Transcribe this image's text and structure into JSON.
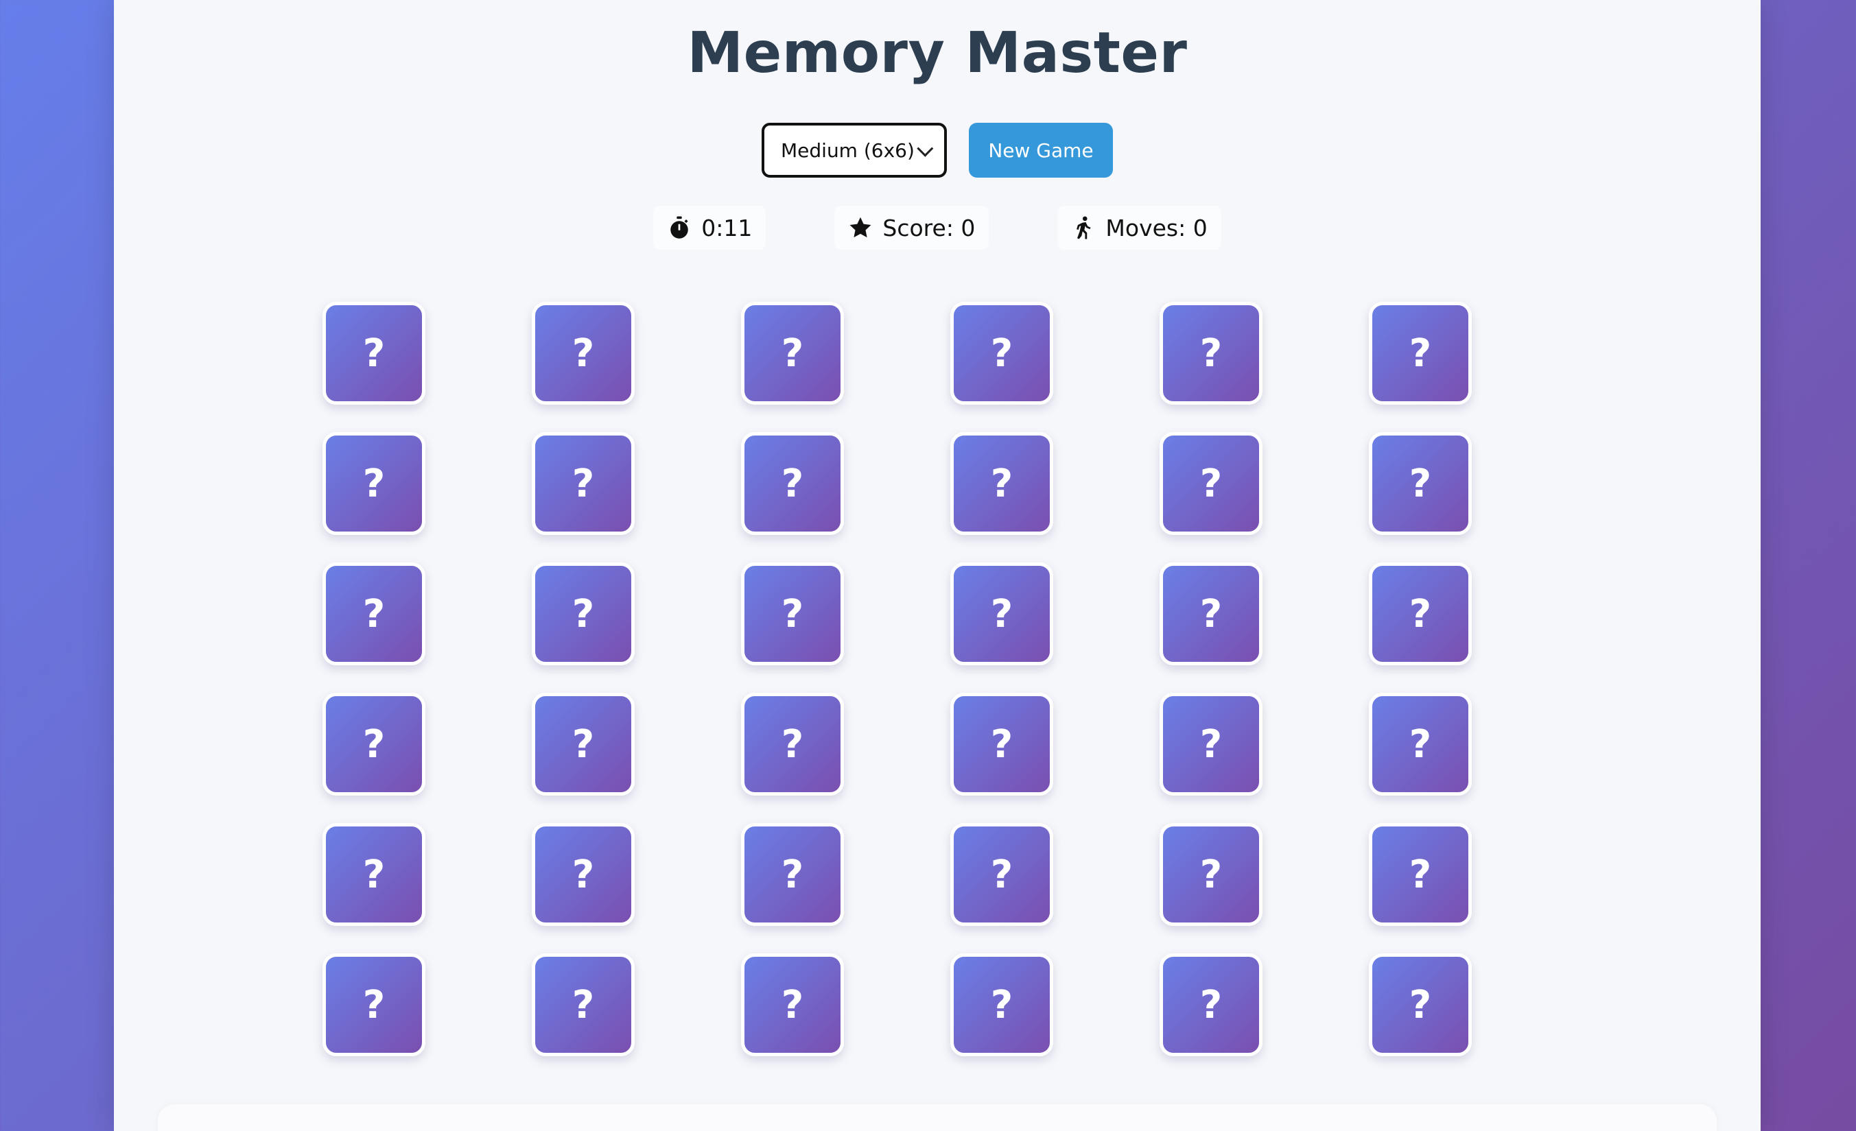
{
  "game": {
    "title": "Memory Master"
  },
  "controls": {
    "difficulty_selected": "Medium (6x6)",
    "new_game_label": "New Game"
  },
  "stats": {
    "timer": "0:11",
    "score": "Score: 0",
    "moves": "Moves: 0"
  },
  "icons": {
    "timer": "stopwatch-icon",
    "score": "star-icon",
    "moves": "walking-person-icon"
  },
  "board": {
    "rows": 6,
    "columns": 6,
    "hidden_symbol": "?"
  },
  "colors": {
    "title": "#2c3e50",
    "button": "#3498db",
    "card_gradient_start": "#6a7fe6",
    "card_gradient_end": "#7a4fb0",
    "background_gradient_start": "#667eea",
    "background_gradient_end": "#764ba2"
  }
}
